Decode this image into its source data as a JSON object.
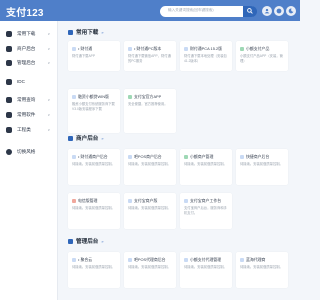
{
  "header": {
    "logo": "支付123",
    "search_placeholder": "输入关键词搜索(回车键搜索)",
    "icons": [
      "search-icon",
      "user-icon",
      "github-icon",
      "moon-icon"
    ]
  },
  "sidebar": {
    "items": [
      {
        "label": "常用下载",
        "icon": "download-icon",
        "caret": "∨"
      },
      {
        "label": "商户后台",
        "icon": "store-icon",
        "caret": "∨"
      },
      {
        "label": "管理后台",
        "icon": "admin-icon",
        "caret": "∨"
      },
      {
        "label": "IDC",
        "icon": "server-icon",
        "caret": ""
      },
      {
        "label": "常用查询",
        "icon": "query-icon",
        "caret": "∨"
      },
      {
        "label": "常用软件",
        "icon": "software-icon",
        "caret": "∨"
      },
      {
        "label": "工程类",
        "icon": "tool-icon",
        "caret": "∨"
      },
      {
        "label": "切换风格",
        "icon": "theme-icon",
        "caret": ""
      }
    ]
  },
  "sections": [
    {
      "title": "常用下载",
      "chevron": "»",
      "cards": [
        {
          "title": "• 财付通",
          "desc": "财付通下载APP",
          "color": "#e8f0fb"
        },
        {
          "title": "• 财付通PC版本",
          "desc": "财付通下载微信APP，财付通的PC服务",
          "color": "#e8f0fb"
        },
        {
          "title": "财付通PCA 15.2版",
          "desc": "财付通下载本地处理（安装包41.2版本）",
          "color": "#e8f0fb"
        },
        {
          "title": "小额支付产品",
          "desc": "小额支付产品APP（安装，管理）",
          "color": "#e5f5ec"
        },
        {
          "title": "融资小额贷WIN版",
          "desc": "融资小额支付系统服务商下载V3.0版安装程序下载",
          "color": "#e8f0fb"
        },
        {
          "title": "支付宝官方APP",
          "desc": "安全便捷，官方推荐使用。",
          "color": "#e5f5ec"
        }
      ]
    },
    {
      "title": "商户后台",
      "chevron": "»",
      "cards": [
        {
          "title": "• 财付通商户后台",
          "desc": "待接续。安装前做质量控制。",
          "color": "#e8f0fb"
        },
        {
          "title": "吧POS商户后台",
          "desc": "待接续。安装前做质量控制。",
          "color": "#e8f0fb"
        },
        {
          "title": "小额商户管理",
          "desc": "待接续。安装前做质量控制。",
          "color": "#e5f5ec"
        },
        {
          "title": "快捷商户后台",
          "desc": "待接续。安装前做质量控制。",
          "color": "#e8f0fb"
        },
        {
          "title": "电信版管理",
          "desc": "待接续。安装前做质量控制。",
          "color": "#fdecea"
        },
        {
          "title": "支付宝商户版",
          "desc": "待接续。安装前做质量控制。",
          "color": "#e8f0fb"
        },
        {
          "title": "支付宝商户工作台",
          "desc": "支付宝商户后台，服务商和手机支付。",
          "color": "#e8f0fb"
        }
      ]
    },
    {
      "title": "管理后台",
      "chevron": "»",
      "cards": [
        {
          "title": "• 聚合云",
          "desc": "待接续。安装前做质量控制。",
          "color": "#e8f0fb"
        },
        {
          "title": "吧POS代理商后台",
          "desc": "待接续。安装前做质量控制。",
          "color": "#e8f0fb"
        },
        {
          "title": "小额支付代理管理",
          "desc": "待接续。安装前做质量控制。",
          "color": "#e8f0fb"
        },
        {
          "title": "蓝海代理商",
          "desc": "待接续。安装前做质量控制。",
          "color": "#e8f0fb"
        }
      ]
    }
  ]
}
